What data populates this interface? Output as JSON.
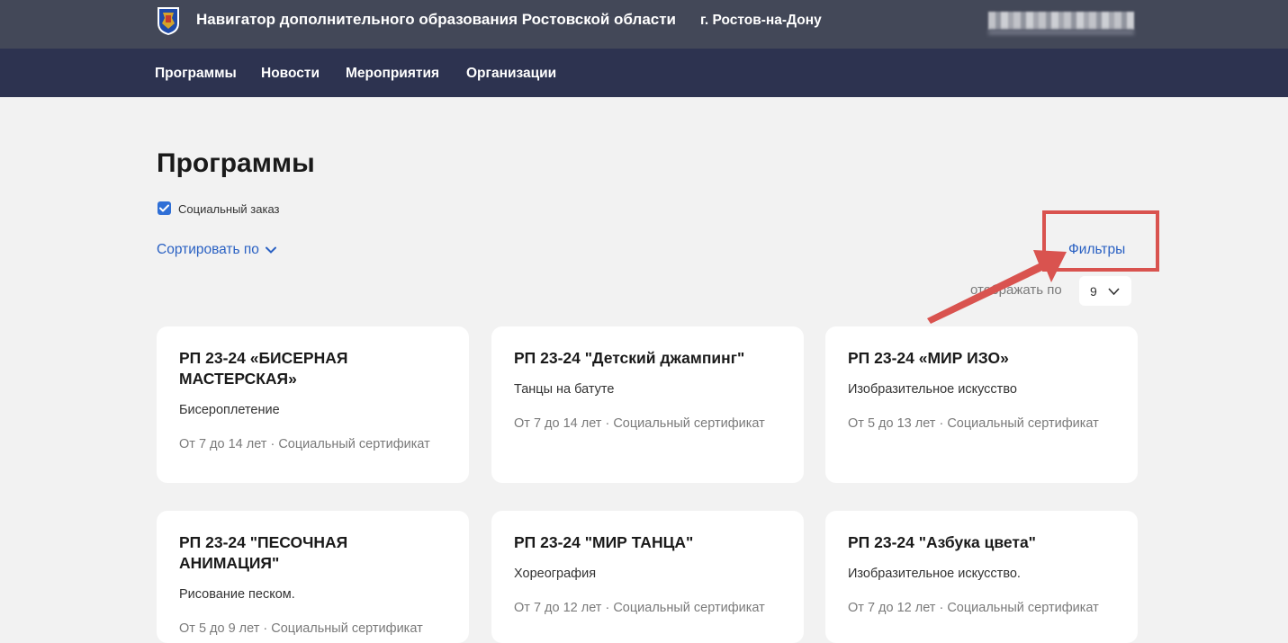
{
  "header": {
    "site_title": "Навигатор дополнительного образования Ростовской области",
    "city": "г. Ростов-на-Дону"
  },
  "nav": {
    "items": [
      {
        "label": "Программы"
      },
      {
        "label": "Новости"
      },
      {
        "label": "Мероприятия"
      },
      {
        "label": "Организации"
      }
    ]
  },
  "main": {
    "title": "Программы",
    "social_order": {
      "label": "Социальный заказ",
      "checked": true
    },
    "sort_label": "Сортировать по",
    "filters_label": "Фильтры",
    "per_page": {
      "label": "отображать по",
      "value": "9"
    }
  },
  "cards": [
    {
      "title": "РП 23-24 «БИСЕРНАЯ МАСТЕРСКАЯ»",
      "subtitle": "Бисероплетение",
      "meta": "От 7 до 14 лет · Социальный сертификат"
    },
    {
      "title": "РП 23-24 \"Детский джампинг\"",
      "subtitle": "Танцы на батуте",
      "meta": "От 7 до 14 лет · Социальный сертификат"
    },
    {
      "title": "РП 23-24 «МИР ИЗО»",
      "subtitle": "Изобразительное искусство",
      "meta": "От 5 до 13 лет · Социальный сертификат"
    },
    {
      "title": "РП 23-24 \"ПЕСОЧНАЯ АНИМАЦИЯ\"",
      "subtitle": "Рисование песком.",
      "meta": "От 5 до 9 лет · Социальный сертификат"
    },
    {
      "title": "РП 23-24 \"МИР ТАНЦА\"",
      "subtitle": "Хореография",
      "meta": "От 7 до 12 лет · Социальный сертификат"
    },
    {
      "title": "РП 23-24 \"Азбука цвета\"",
      "subtitle": "Изобразительное искусство.",
      "meta": "От 7 до 12 лет · Социальный сертификат"
    }
  ],
  "colors": {
    "topbar": "#434858",
    "navbar": "#2d3350",
    "accent": "#2a61c3",
    "annotation": "#d9534f"
  }
}
